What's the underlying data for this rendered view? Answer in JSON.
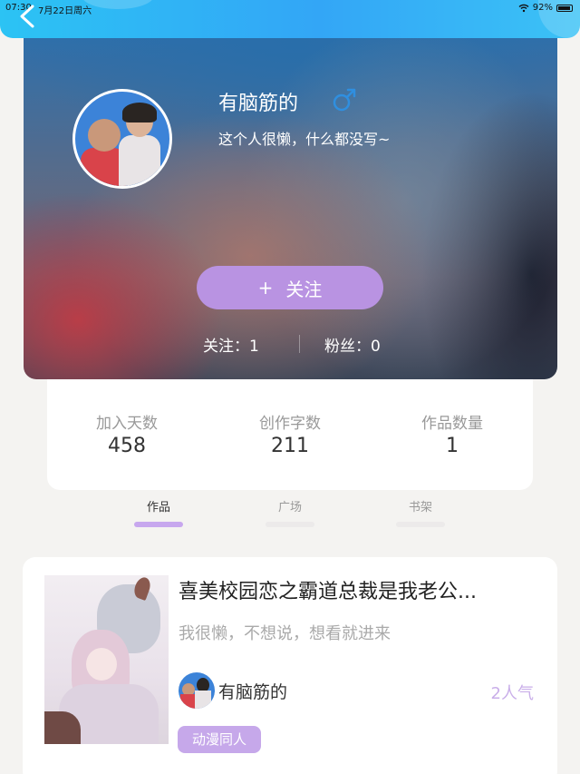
{
  "status_bar": {
    "time": "07:30",
    "date": "7月22日周六",
    "battery": "92%"
  },
  "profile": {
    "name": "有脑筋的",
    "gender_icon": "male-icon",
    "bio": "这个人很懒，什么都没写~",
    "follow_button": {
      "icon": "+",
      "label": "关注"
    },
    "following": "关注：1",
    "fans": "粉丝：0"
  },
  "stats": [
    {
      "label": "加入天数",
      "value": "458"
    },
    {
      "label": "创作字数",
      "value": "211"
    },
    {
      "label": "作品数量",
      "value": "1"
    }
  ],
  "tabs": [
    {
      "label": "作品",
      "active": true
    },
    {
      "label": "广场",
      "active": false
    },
    {
      "label": "书架",
      "active": false
    }
  ],
  "work": {
    "title": "喜美校园恋之霸道总裁是我老公...",
    "description": "我很懒，不想说，想看就进来",
    "author": "有脑筋的",
    "popularity": "2人气",
    "tag": "动漫同人"
  },
  "colors": {
    "accent": "#b993e2",
    "header": "#33a6f6",
    "tab_active": "#c7a7ee"
  }
}
